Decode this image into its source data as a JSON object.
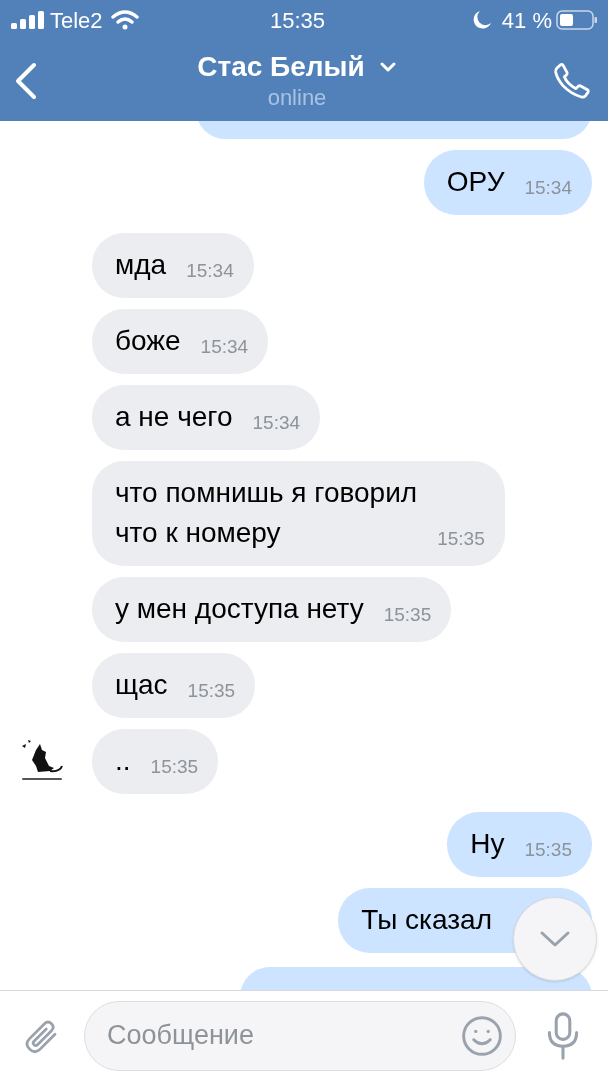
{
  "status_bar": {
    "carrier": "Tele2",
    "time": "15:35",
    "battery": "41 %"
  },
  "header": {
    "title": "Стас Белый",
    "subtitle": "online"
  },
  "messages": [
    {
      "outgoing": false,
      "lines": [
        "мда"
      ],
      "time": "15:34",
      "avatar": false
    },
    {
      "outgoing": false,
      "lines": [
        "боже"
      ],
      "time": "15:34",
      "avatar": false
    },
    {
      "outgoing": false,
      "lines": [
        "а не чего"
      ],
      "time": "15:34",
      "avatar": false
    },
    {
      "outgoing": false,
      "lines": [
        "что помнишь я говорил",
        "что к номеру"
      ],
      "time": "15:35",
      "avatar": false
    },
    {
      "outgoing": false,
      "lines": [
        "у мен доступа нету"
      ],
      "time": "15:35",
      "avatar": false
    },
    {
      "outgoing": false,
      "lines": [
        "щас"
      ],
      "time": "15:35",
      "avatar": false
    },
    {
      "outgoing": false,
      "lines": [
        ".."
      ],
      "time": "15:35",
      "avatar": true
    },
    {
      "outgoing": true,
      "lines": [
        "Ну"
      ],
      "time": "15:35"
    },
    {
      "outgoing": true,
      "lines": [
        "Ты сказал"
      ]
    }
  ],
  "first_message": {
    "outgoing": true,
    "lines": [
      "ОРУ"
    ],
    "time": "15:34"
  },
  "composer": {
    "placeholder": "Сообщение"
  }
}
